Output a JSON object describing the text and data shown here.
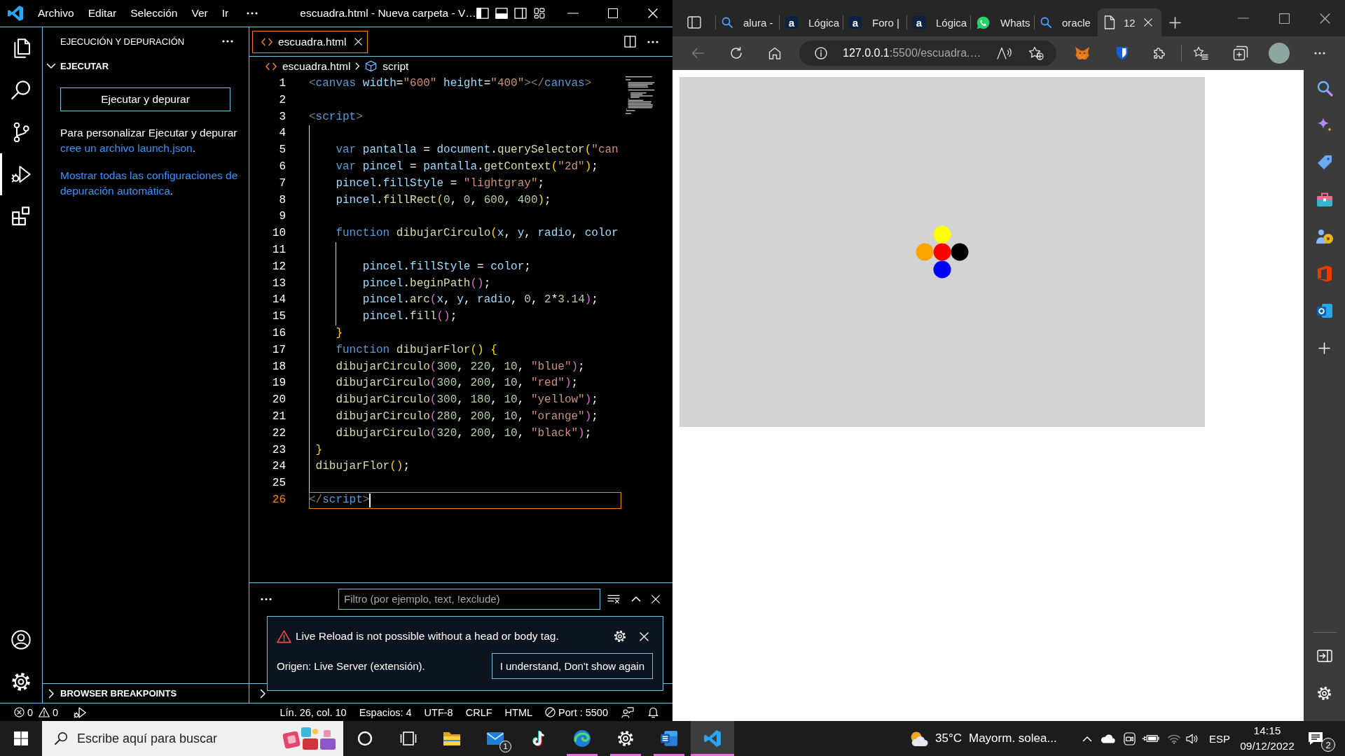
{
  "vscode": {
    "title_bar": {
      "menus": [
        "Archivo",
        "Editar",
        "Selección",
        "Ver",
        "Ir"
      ],
      "title": "escuadra.html - Nueva carpeta - V…"
    },
    "activity_bar": [
      {
        "kind": "explorer",
        "selected": false
      },
      {
        "kind": "search",
        "selected": false
      },
      {
        "kind": "source-control",
        "selected": false
      },
      {
        "kind": "run-debug",
        "selected": true
      },
      {
        "kind": "extensions",
        "selected": false
      }
    ],
    "sidebar": {
      "title": "EJECUCIÓN Y DEPURACIÓN",
      "sections": [
        {
          "title": "EJECUTAR",
          "expanded": true,
          "button": "Ejecutar y depurar",
          "paragraphs": [
            [
              {
                "kind": "text",
                "text": "Para personalizar Ejecutar y depurar "
              },
              {
                "kind": "link",
                "text": "cree un archivo launch.json"
              },
              {
                "kind": "text",
                "text": "."
              }
            ],
            [
              {
                "kind": "link",
                "text": "Mostrar todas las configuraciones de depuración automática"
              },
              {
                "kind": "text",
                "text": "."
              }
            ]
          ]
        },
        {
          "title": "BROWSER BREAKPOINTS",
          "expanded": false
        }
      ]
    },
    "editor": {
      "tabs": [
        {
          "label": "escuadra.html",
          "selected": true
        }
      ],
      "breadcrumb": [
        {
          "kind": "file",
          "label": "escuadra.html"
        },
        {
          "kind": "symbol",
          "label": "script"
        }
      ],
      "lines": [
        {
          "number": "1",
          "current": false,
          "tokens": [
            {
              "kind": "tag-delim",
              "text": "<"
            },
            {
              "kind": "tag",
              "text": "canvas"
            },
            {
              "kind": "attr",
              "text": " width"
            },
            {
              "kind": "plain",
              "text": "="
            },
            {
              "kind": "string",
              "text": "\"600\""
            },
            {
              "kind": "attr",
              "text": " height"
            },
            {
              "kind": "plain",
              "text": "="
            },
            {
              "kind": "string",
              "text": "\"400\""
            },
            {
              "kind": "tag-delim",
              "text": "></"
            },
            {
              "kind": "tag",
              "text": "canvas"
            },
            {
              "kind": "tag-delim",
              "text": ">"
            }
          ]
        },
        {
          "number": "2",
          "current": false
        },
        {
          "number": "3",
          "current": false,
          "tokens": [
            {
              "kind": "tag-delim",
              "text": "<"
            },
            {
              "kind": "tag",
              "text": "script"
            },
            {
              "kind": "tag-delim",
              "text": ">"
            }
          ]
        },
        {
          "number": "4",
          "current": false
        },
        {
          "number": "5",
          "current": false,
          "tokens": [
            {
              "kind": "keyword",
              "text": "    var"
            },
            {
              "kind": "variable",
              "text": " pantalla"
            },
            {
              "kind": "plain",
              "text": " = "
            },
            {
              "kind": "variable",
              "text": "document"
            },
            {
              "kind": "plain",
              "text": "."
            },
            {
              "kind": "function",
              "text": "querySelector"
            },
            {
              "kind": "bracket-1",
              "text": "("
            },
            {
              "kind": "string",
              "text": "\"can"
            }
          ]
        },
        {
          "number": "6",
          "current": false,
          "tokens": [
            {
              "kind": "keyword",
              "text": "    var"
            },
            {
              "kind": "variable",
              "text": " pincel"
            },
            {
              "kind": "plain",
              "text": " = "
            },
            {
              "kind": "variable",
              "text": "pantalla"
            },
            {
              "kind": "plain",
              "text": "."
            },
            {
              "kind": "function",
              "text": "getContext"
            },
            {
              "kind": "bracket-1",
              "text": "("
            },
            {
              "kind": "string",
              "text": "\"2d\""
            },
            {
              "kind": "bracket-1",
              "text": ")"
            },
            {
              "kind": "plain",
              "text": ";"
            }
          ]
        },
        {
          "number": "7",
          "current": false,
          "tokens": [
            {
              "kind": "variable",
              "text": "    pincel"
            },
            {
              "kind": "plain",
              "text": "."
            },
            {
              "kind": "variable",
              "text": "fillStyle"
            },
            {
              "kind": "plain",
              "text": " = "
            },
            {
              "kind": "string",
              "text": "\"lightgray\""
            },
            {
              "kind": "plain",
              "text": ";"
            }
          ]
        },
        {
          "number": "8",
          "current": false,
          "tokens": [
            {
              "kind": "variable",
              "text": "    pincel"
            },
            {
              "kind": "plain",
              "text": "."
            },
            {
              "kind": "function",
              "text": "fillRect"
            },
            {
              "kind": "bracket-1",
              "text": "("
            },
            {
              "kind": "number",
              "text": "0"
            },
            {
              "kind": "plain",
              "text": ", "
            },
            {
              "kind": "number",
              "text": "0"
            },
            {
              "kind": "plain",
              "text": ", "
            },
            {
              "kind": "number",
              "text": "600"
            },
            {
              "kind": "plain",
              "text": ", "
            },
            {
              "kind": "number",
              "text": "400"
            },
            {
              "kind": "bracket-1",
              "text": ")"
            },
            {
              "kind": "plain",
              "text": ";"
            }
          ]
        },
        {
          "number": "9",
          "current": false
        },
        {
          "number": "10",
          "current": false,
          "tokens": [
            {
              "kind": "keyword",
              "text": "    function"
            },
            {
              "kind": "function",
              "text": " dibujarCirculo"
            },
            {
              "kind": "bracket-1",
              "text": "("
            },
            {
              "kind": "variable",
              "text": "x"
            },
            {
              "kind": "plain",
              "text": ", "
            },
            {
              "kind": "variable",
              "text": "y"
            },
            {
              "kind": "plain",
              "text": ", "
            },
            {
              "kind": "variable",
              "text": "radio"
            },
            {
              "kind": "plain",
              "text": ", "
            },
            {
              "kind": "variable",
              "text": "color"
            }
          ]
        },
        {
          "number": "11",
          "current": false
        },
        {
          "number": "12",
          "current": false,
          "tokens": [
            {
              "kind": "variable",
              "text": "        pincel"
            },
            {
              "kind": "plain",
              "text": "."
            },
            {
              "kind": "variable",
              "text": "fillStyle"
            },
            {
              "kind": "plain",
              "text": " = "
            },
            {
              "kind": "variable",
              "text": "color"
            },
            {
              "kind": "plain",
              "text": ";"
            }
          ]
        },
        {
          "number": "13",
          "current": false,
          "tokens": [
            {
              "kind": "variable",
              "text": "        pincel"
            },
            {
              "kind": "plain",
              "text": "."
            },
            {
              "kind": "function",
              "text": "beginPath"
            },
            {
              "kind": "bracket-2",
              "text": "()"
            },
            {
              "kind": "plain",
              "text": ";"
            }
          ]
        },
        {
          "number": "14",
          "current": false,
          "tokens": [
            {
              "kind": "variable",
              "text": "        pincel"
            },
            {
              "kind": "plain",
              "text": "."
            },
            {
              "kind": "function",
              "text": "arc"
            },
            {
              "kind": "bracket-2",
              "text": "("
            },
            {
              "kind": "variable",
              "text": "x"
            },
            {
              "kind": "plain",
              "text": ", "
            },
            {
              "kind": "variable",
              "text": "y"
            },
            {
              "kind": "plain",
              "text": ", "
            },
            {
              "kind": "variable",
              "text": "radio"
            },
            {
              "kind": "plain",
              "text": ", "
            },
            {
              "kind": "number",
              "text": "0"
            },
            {
              "kind": "plain",
              "text": ", "
            },
            {
              "kind": "number",
              "text": "2"
            },
            {
              "kind": "plain",
              "text": "*"
            },
            {
              "kind": "number",
              "text": "3.14"
            },
            {
              "kind": "bracket-2",
              "text": ")"
            },
            {
              "kind": "plain",
              "text": ";"
            }
          ]
        },
        {
          "number": "15",
          "current": false,
          "tokens": [
            {
              "kind": "variable",
              "text": "        pincel"
            },
            {
              "kind": "plain",
              "text": "."
            },
            {
              "kind": "function",
              "text": "fill"
            },
            {
              "kind": "bracket-2",
              "text": "()"
            },
            {
              "kind": "plain",
              "text": ";"
            }
          ]
        },
        {
          "number": "16",
          "current": false,
          "tokens": [
            {
              "kind": "bracket-1",
              "text": "    }"
            }
          ]
        },
        {
          "number": "17",
          "current": false,
          "tokens": [
            {
              "kind": "keyword",
              "text": "    function"
            },
            {
              "kind": "function",
              "text": " dibujarFlor"
            },
            {
              "kind": "bracket-1",
              "text": "()"
            },
            {
              "kind": "bracket-1",
              "text": " {"
            }
          ]
        },
        {
          "number": "18",
          "current": false,
          "tokens": [
            {
              "kind": "function",
              "text": "    dibujarCirculo"
            },
            {
              "kind": "bracket-2",
              "text": "("
            },
            {
              "kind": "number",
              "text": "300"
            },
            {
              "kind": "plain",
              "text": ", "
            },
            {
              "kind": "number",
              "text": "220"
            },
            {
              "kind": "plain",
              "text": ", "
            },
            {
              "kind": "number",
              "text": "10"
            },
            {
              "kind": "plain",
              "text": ", "
            },
            {
              "kind": "string",
              "text": "\"blue\""
            },
            {
              "kind": "bracket-2",
              "text": ")"
            },
            {
              "kind": "plain",
              "text": ";"
            }
          ]
        },
        {
          "number": "19",
          "current": false,
          "tokens": [
            {
              "kind": "function",
              "text": "    dibujarCirculo"
            },
            {
              "kind": "bracket-2",
              "text": "("
            },
            {
              "kind": "number",
              "text": "300"
            },
            {
              "kind": "plain",
              "text": ", "
            },
            {
              "kind": "number",
              "text": "200"
            },
            {
              "kind": "plain",
              "text": ", "
            },
            {
              "kind": "number",
              "text": "10"
            },
            {
              "kind": "plain",
              "text": ", "
            },
            {
              "kind": "string",
              "text": "\"red\""
            },
            {
              "kind": "bracket-2",
              "text": ")"
            },
            {
              "kind": "plain",
              "text": ";"
            }
          ]
        },
        {
          "number": "20",
          "current": false,
          "tokens": [
            {
              "kind": "function",
              "text": "    dibujarCirculo"
            },
            {
              "kind": "bracket-2",
              "text": "("
            },
            {
              "kind": "number",
              "text": "300"
            },
            {
              "kind": "plain",
              "text": ", "
            },
            {
              "kind": "number",
              "text": "180"
            },
            {
              "kind": "plain",
              "text": ", "
            },
            {
              "kind": "number",
              "text": "10"
            },
            {
              "kind": "plain",
              "text": ", "
            },
            {
              "kind": "string",
              "text": "\"yellow\""
            },
            {
              "kind": "bracket-2",
              "text": ")"
            },
            {
              "kind": "plain",
              "text": ";"
            }
          ]
        },
        {
          "number": "21",
          "current": false,
          "tokens": [
            {
              "kind": "function",
              "text": "    dibujarCirculo"
            },
            {
              "kind": "bracket-2",
              "text": "("
            },
            {
              "kind": "number",
              "text": "280"
            },
            {
              "kind": "plain",
              "text": ", "
            },
            {
              "kind": "number",
              "text": "200"
            },
            {
              "kind": "plain",
              "text": ", "
            },
            {
              "kind": "number",
              "text": "10"
            },
            {
              "kind": "plain",
              "text": ", "
            },
            {
              "kind": "string",
              "text": "\"orange\""
            },
            {
              "kind": "bracket-2",
              "text": ")"
            },
            {
              "kind": "plain",
              "text": ";"
            }
          ]
        },
        {
          "number": "22",
          "current": false,
          "tokens": [
            {
              "kind": "function",
              "text": "    dibujarCirculo"
            },
            {
              "kind": "bracket-2",
              "text": "("
            },
            {
              "kind": "number",
              "text": "320"
            },
            {
              "kind": "plain",
              "text": ", "
            },
            {
              "kind": "number",
              "text": "200"
            },
            {
              "kind": "plain",
              "text": ", "
            },
            {
              "kind": "number",
              "text": "10"
            },
            {
              "kind": "plain",
              "text": ", "
            },
            {
              "kind": "string",
              "text": "\"black\""
            },
            {
              "kind": "bracket-2",
              "text": ")"
            },
            {
              "kind": "plain",
              "text": ";"
            }
          ]
        },
        {
          "number": "23",
          "current": false,
          "tokens": [
            {
              "kind": "bracket-1",
              "text": " }"
            }
          ]
        },
        {
          "number": "24",
          "current": false,
          "tokens": [
            {
              "kind": "function",
              "text": " dibujarFlor"
            },
            {
              "kind": "bracket-1",
              "text": "()"
            },
            {
              "kind": "plain",
              "text": ";"
            }
          ]
        },
        {
          "number": "25",
          "current": false
        },
        {
          "number": "26",
          "current": true,
          "tokens": [
            {
              "kind": "tag-delim",
              "text": "</"
            },
            {
              "kind": "tag",
              "text": "script"
            },
            {
              "kind": "tag-delim",
              "text": ">"
            }
          ]
        }
      ]
    },
    "panel": {
      "filter": {
        "placeholder": "Filtro (por ejemplo, text, !exclude)"
      }
    },
    "notification": {
      "kind": "warning",
      "message": "Live Reload is not possible without a head or body tag.",
      "source": "Origen: Live Server (extensión).",
      "button": "I understand, Don't show again"
    },
    "status_bar": {
      "errors": "0",
      "warnings": "0",
      "items": [
        "Lín. 26, col. 10",
        "Espacios: 4",
        "UTF-8",
        "CRLF",
        "HTML"
      ],
      "port": "Port : 5500"
    }
  },
  "browser": {
    "tabs": [
      {
        "kind": "search",
        "label": "alura -",
        "selected": false
      },
      {
        "kind": "letter",
        "favicon_text": "a",
        "label": "Lógica",
        "selected": false
      },
      {
        "kind": "letter",
        "favicon_text": "a",
        "label": "Foro |",
        "selected": false
      },
      {
        "kind": "letter",
        "favicon_text": "a",
        "label": "Lógica",
        "selected": false
      },
      {
        "kind": "chat",
        "label": "Whats",
        "selected": false
      },
      {
        "kind": "search",
        "label": "oracle",
        "selected": false
      },
      {
        "kind": "page",
        "label": "12",
        "selected": true
      }
    ],
    "back_button": {
      "disabled": true
    },
    "address": {
      "host": "127.0.0.1",
      "path": ":5500/escuadra.…"
    },
    "page": {
      "circles": [
        {
          "kind": "bottom",
          "color": "#0000ff"
        },
        {
          "kind": "center",
          "color": "#ff0000"
        },
        {
          "kind": "top",
          "color": "#ffff00"
        },
        {
          "kind": "left",
          "color": "#ffa500"
        },
        {
          "kind": "right",
          "color": "#000000"
        }
      ]
    }
  },
  "taskbar": {
    "search": {
      "placeholder": "Escribe aquí para buscar"
    },
    "apps": [
      {
        "kind": "cortana",
        "running": false,
        "selected": false
      },
      {
        "kind": "task-view",
        "running": false,
        "selected": false
      },
      {
        "kind": "file-explorer",
        "running": false,
        "selected": false
      },
      {
        "kind": "mail",
        "running": false,
        "selected": false,
        "badge": "1"
      },
      {
        "kind": "tiktok",
        "running": false,
        "selected": false
      },
      {
        "kind": "edge",
        "running": true,
        "selected": false
      },
      {
        "kind": "settings",
        "running": true,
        "selected": false
      },
      {
        "kind": "word",
        "running": true,
        "selected": false
      },
      {
        "kind": "vscode",
        "running": true,
        "selected": true
      }
    ],
    "weather": {
      "temperature": "35°C",
      "condition": "Mayorm. solea..."
    },
    "language": "ESP",
    "time": "14:15",
    "date": "09/12/2022",
    "notifications": "2"
  }
}
